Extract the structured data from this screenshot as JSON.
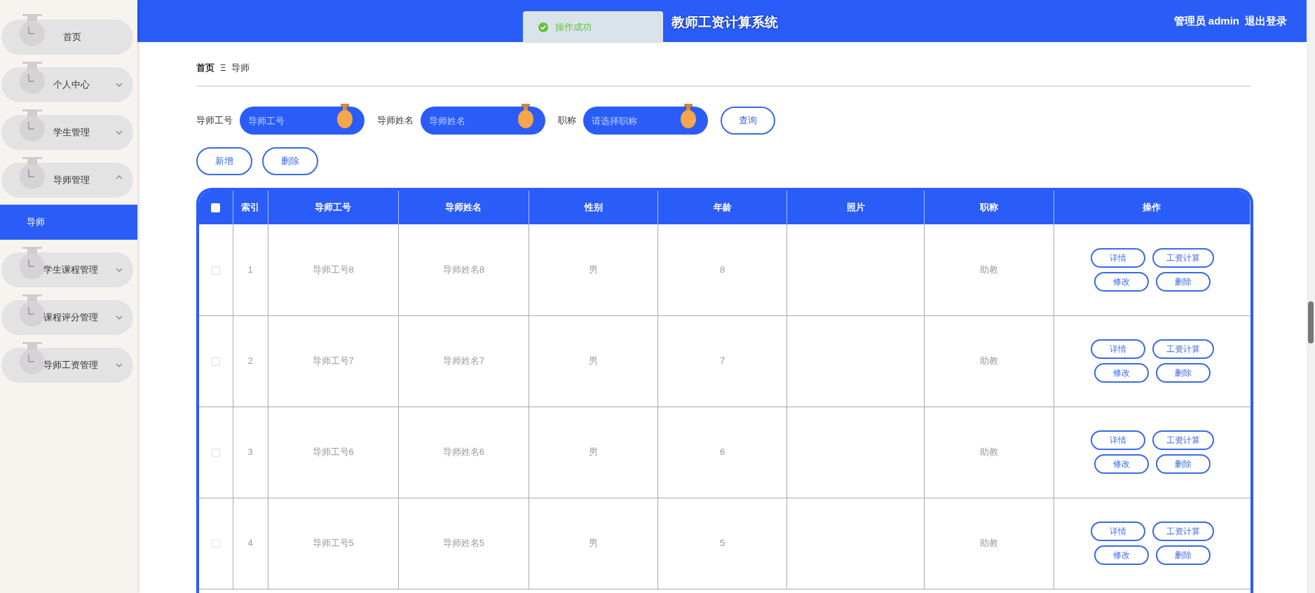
{
  "header": {
    "title": "教师工资计算系统",
    "user": "管理员 admin",
    "logout": "退出登录"
  },
  "toast": {
    "message": "操作成功"
  },
  "sidebar": {
    "items": [
      {
        "label": "首页"
      },
      {
        "label": "个人中心",
        "expanded": false
      },
      {
        "label": "学生管理",
        "expanded": false
      },
      {
        "label": "导师管理",
        "expanded": true,
        "children": [
          {
            "label": "导师",
            "selected": true
          }
        ]
      },
      {
        "label": "学生课程管理",
        "expanded": false
      },
      {
        "label": "课程评分管理",
        "expanded": false
      },
      {
        "label": "导师工资管理",
        "expanded": false
      }
    ]
  },
  "breadcrumb": [
    "首页",
    "导师"
  ],
  "breadcrumb_separator": "Ξ",
  "filters": [
    {
      "label": "导师工号",
      "placeholder": "导师工号",
      "kind": "input"
    },
    {
      "label": "导师姓名",
      "placeholder": "导师姓名",
      "kind": "input"
    },
    {
      "label": "职称",
      "placeholder": "请选择职称",
      "kind": "select"
    }
  ],
  "search_button": "查询",
  "actions": [
    "新增",
    "删除"
  ],
  "table": {
    "header_checked": false,
    "columns": [
      "索引",
      "导师工号",
      "导师姓名",
      "性别",
      "年龄",
      "照片",
      "职称",
      "操作"
    ],
    "rows": [
      {
        "checked": false,
        "cells": [
          "1",
          "导师工号8",
          "导师姓名8",
          "男",
          "8",
          "",
          "助教"
        ],
        "buttons": [
          "详情",
          "工资计算",
          "修改",
          "删除"
        ]
      },
      {
        "checked": false,
        "cells": [
          "2",
          "导师工号7",
          "导师姓名7",
          "男",
          "7",
          "",
          "助教"
        ],
        "buttons": [
          "详情",
          "工资计算",
          "修改",
          "删除"
        ]
      },
      {
        "checked": false,
        "cells": [
          "3",
          "导师工号6",
          "导师姓名6",
          "男",
          "6",
          "",
          "助教"
        ],
        "buttons": [
          "详情",
          "工资计算",
          "修改",
          "删除"
        ]
      },
      {
        "checked": false,
        "cells": [
          "4",
          "导师工号5",
          "导师姓名5",
          "男",
          "5",
          "",
          "助教"
        ],
        "buttons": [
          "详情",
          "工资计算",
          "修改",
          "删除"
        ]
      }
    ]
  }
}
